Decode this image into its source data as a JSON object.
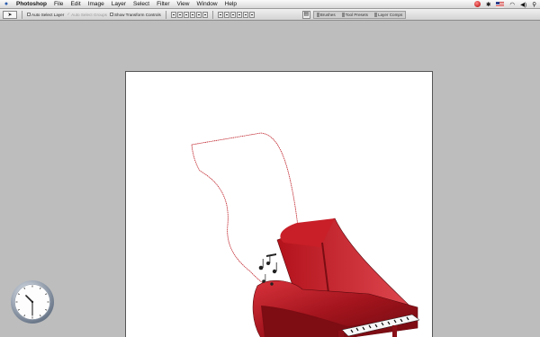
{
  "menubar": {
    "app_name": "Photoshop",
    "items": [
      "File",
      "Edit",
      "Image",
      "Layer",
      "Select",
      "Filter",
      "View",
      "Window",
      "Help"
    ],
    "status_icons": [
      "red-status-icon",
      "bluetooth-icon",
      "us-flag-icon",
      "wifi-icon",
      "volume-icon",
      "spotlight-icon"
    ]
  },
  "options_bar": {
    "tool": "move-tool",
    "auto_select_layer": "Auto Select Layer",
    "auto_select_groups": "Auto Select Groups",
    "show_transform_controls": "Show Transform Controls",
    "palette_well": [
      "Brushes",
      "Tool Presets",
      "Layer Comps"
    ]
  },
  "document": {
    "content": "red grand piano with floating music sheet selection"
  },
  "clock": {
    "hour": 10,
    "minute": 30
  }
}
